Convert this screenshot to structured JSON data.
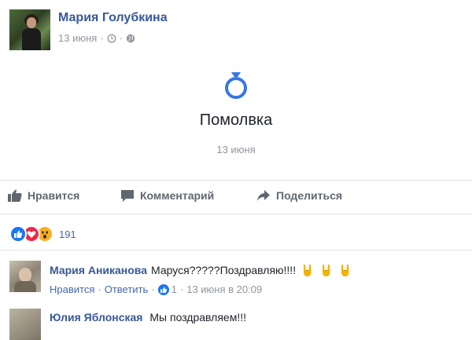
{
  "post": {
    "author": "Мария Голубкина",
    "date": "13 июня",
    "meta_icons": [
      "clock-icon",
      "globe-icon"
    ]
  },
  "event": {
    "icon": "ring-icon",
    "title": "Помолвка",
    "date": "13 июня"
  },
  "actions": {
    "like": "Нравится",
    "comment": "Комментарий",
    "share": "Поделиться"
  },
  "reactions": {
    "types": [
      "like",
      "love",
      "wow"
    ],
    "count": "191"
  },
  "comment": {
    "author": "Мария Аниканова",
    "text": "Маруся?????Поздравляю!!!!",
    "emoji": [
      "horns-emoji",
      "horns-emoji",
      "horns-emoji"
    ],
    "like_link": "Нравится",
    "reply_link": "Ответить",
    "likes": "1",
    "timestamp": "13 июня в 20:09"
  },
  "next_comment": {
    "author": "Юлия Яблонская",
    "text": "Мы поздравляем!!!"
  },
  "colors": {
    "link_blue": "#385898",
    "accent_blue": "#4267b2",
    "ring_blue": "#3578e5",
    "muted_gray": "#90949c",
    "action_gray": "#606770"
  }
}
